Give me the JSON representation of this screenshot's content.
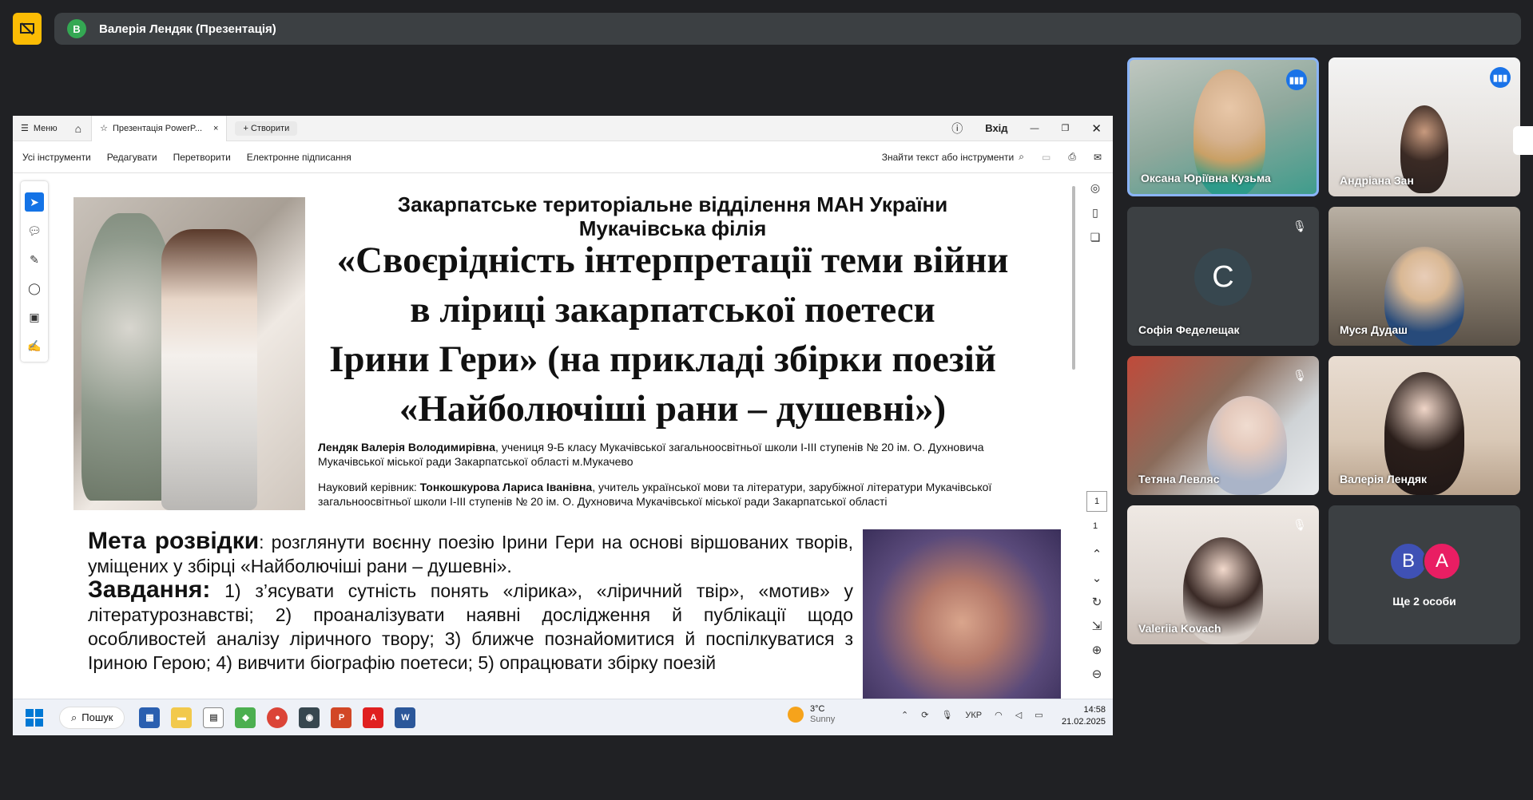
{
  "meeting": {
    "presenter_initial": "В",
    "presenter_title": "Валерія Лендяк (Презентація)"
  },
  "app": {
    "menu_label": "Меню",
    "tab_title": "Презентація PowerP...",
    "new_tab_label": "Створити",
    "login_label": "Вхід"
  },
  "toolbar": {
    "items": [
      "Усі інструменти",
      "Редагувати",
      "Перетворити",
      "Електронне підписання"
    ],
    "search_label": "Знайти текст або інструменти"
  },
  "viewer": {
    "current_page": "1",
    "total_pages": "1"
  },
  "slide": {
    "org_line1": "Закарпатське територіальне відділення МАН України",
    "org_line2": "Мукачівська філія",
    "title_line1": "«Своєрідність інтерпретації теми війни",
    "title_line2": "в ліриці закарпатської поетеси",
    "title_line3": "Ірини Гери» (на прикладі збірки поезій",
    "title_line4": "«Найболючіші рани – душевні»)",
    "author_name": "Лендяк Валерія Володимирівна",
    "author_rest": ", учениця 9-Б класу Мукачівської загальноосвітньої школи І-ІІІ ступенів № 20 ім. О. Духновича Мукачівської міської ради Закарпатської області  м.Мукачево",
    "advisor_prefix": "Науковий керівник: ",
    "advisor_name": "Тонкошкурова Лариса Іванівна",
    "advisor_rest": ", учитель української мови та літератури, зарубіжної літератури Мукачівської загальноосвітньої школи І-ІІІ ступенів № 20 ім. О. Духновича Мукачівської міської ради Закарпатської області",
    "goal_label": "Мета розвідки",
    "goal_text": ": розглянути воєнну поезію Ірини Гери на основі віршованих творів, уміщених у збірці «Найболючіші рани – душевні».",
    "tasks_label": "Завдання:",
    "tasks_text": " 1) з’ясувати сутність понять «лірика», «ліричний твір», «мотив» у літературознавстві; 2) проаналізувати наявні дослідження й публікації щодо особливостей аналізу ліричного твору; 3) ближче познайомитися й поспілкуватися з Іриною Герою; 4) вивчити біографію поетеси; 5) опрацювати збірку поезій"
  },
  "taskbar": {
    "search_label": "Пошук",
    "weather_temp": "3°C",
    "weather_desc": "Sunny",
    "lang": "УКР",
    "time": "14:58",
    "date": "21.02.2025"
  },
  "participants": [
    {
      "name": "Оксана Юріївна Кузьма",
      "speaking": true
    },
    {
      "name": "Андріана Зан",
      "speaking": true
    },
    {
      "name": "Софія Феделещак",
      "initial": "С",
      "muted": true
    },
    {
      "name": "Муся Дудаш"
    },
    {
      "name": "Тетяна Левляс",
      "muted": true
    },
    {
      "name": "Валерія Лендяк"
    },
    {
      "name": "Valeriia Kovach",
      "muted": true
    }
  ],
  "more": {
    "initials": [
      "В",
      "А"
    ],
    "colors": [
      "#3f51b5",
      "#e91e63"
    ],
    "label": "Ще 2 особи"
  },
  "colors": {
    "background": "#202124",
    "tile": "#3c4043",
    "accent": "#1a73e8",
    "active_border": "#8ab4f8"
  }
}
